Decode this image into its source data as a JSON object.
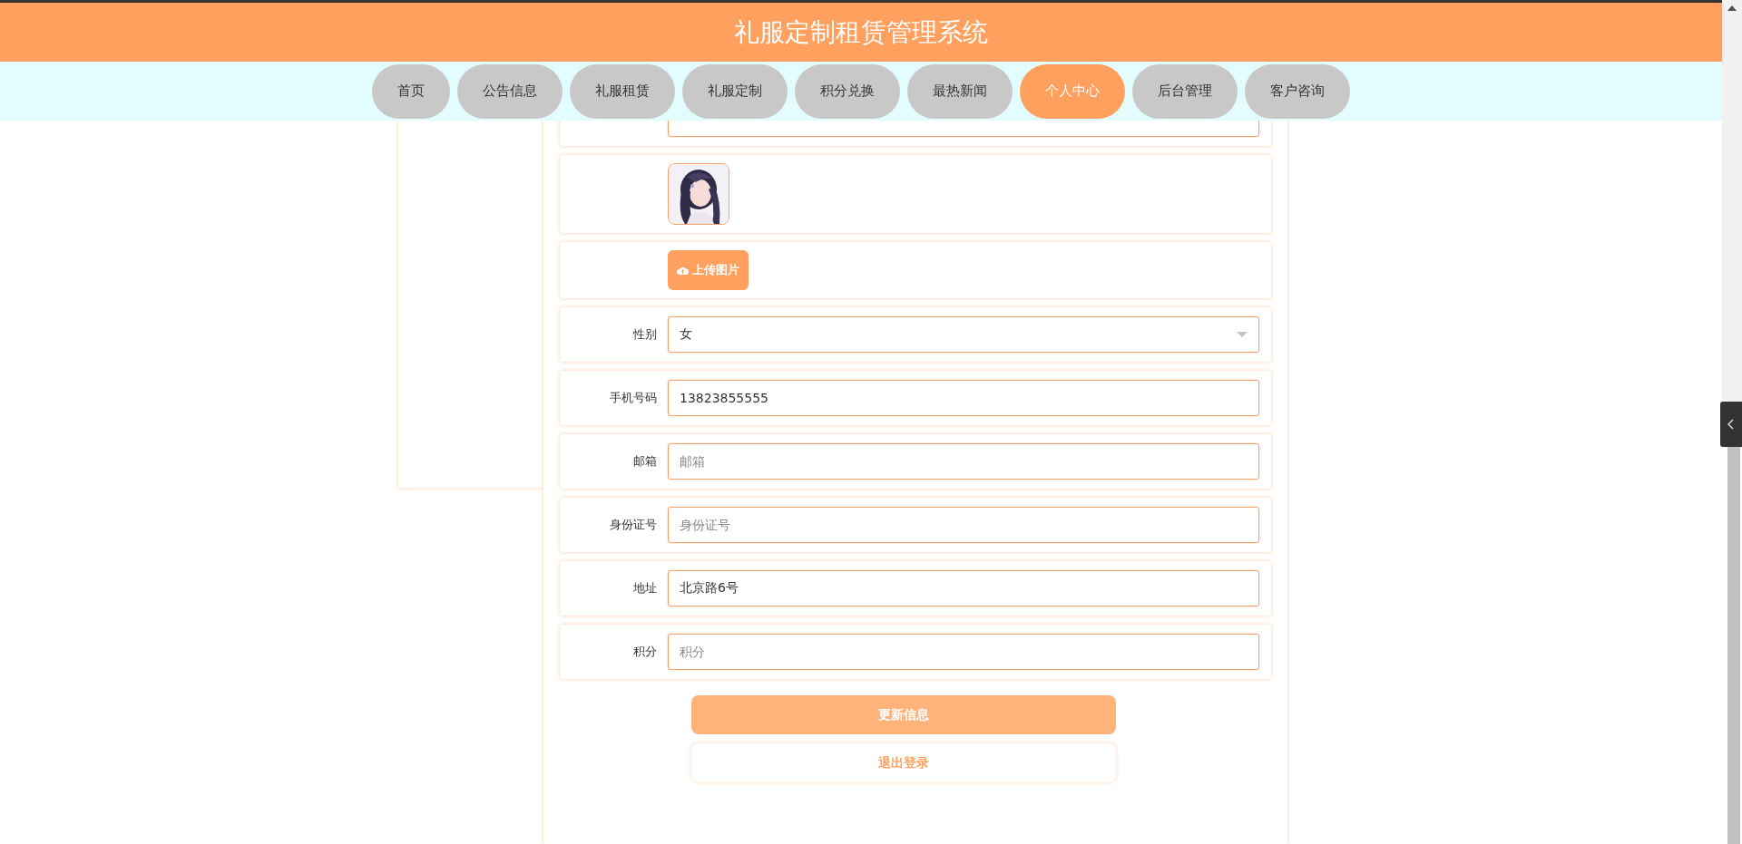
{
  "header": {
    "title": "礼服定制租赁管理系统"
  },
  "nav": [
    {
      "label": "首页",
      "selected": false
    },
    {
      "label": "公告信息",
      "selected": false
    },
    {
      "label": "礼服租赁",
      "selected": false
    },
    {
      "label": "礼服定制",
      "selected": false
    },
    {
      "label": "积分兑换",
      "selected": false
    },
    {
      "label": "最热新闻",
      "selected": false
    },
    {
      "label": "个人中心",
      "selected": true
    },
    {
      "label": "后台管理",
      "selected": false
    },
    {
      "label": "客户咨询",
      "selected": false
    }
  ],
  "form": {
    "rows": [
      {
        "kind": "clipped"
      },
      {
        "kind": "avatar"
      },
      {
        "kind": "upload",
        "button": "上传图片"
      },
      {
        "kind": "select",
        "label": "性别",
        "value": "女"
      },
      {
        "kind": "input",
        "label": "手机号码",
        "value": "13823855555"
      },
      {
        "kind": "input",
        "label": "邮箱",
        "placeholder": "邮箱"
      },
      {
        "kind": "input",
        "label": "身份证号",
        "placeholder": "身份证号"
      },
      {
        "kind": "input",
        "label": "地址",
        "value": "北京路6号"
      },
      {
        "kind": "input",
        "label": "积分",
        "placeholder": "积分"
      }
    ]
  },
  "buttons": [
    {
      "label": "更新信息",
      "kind": "primary"
    },
    {
      "label": "退出登录",
      "kind": "secondary"
    }
  ]
}
